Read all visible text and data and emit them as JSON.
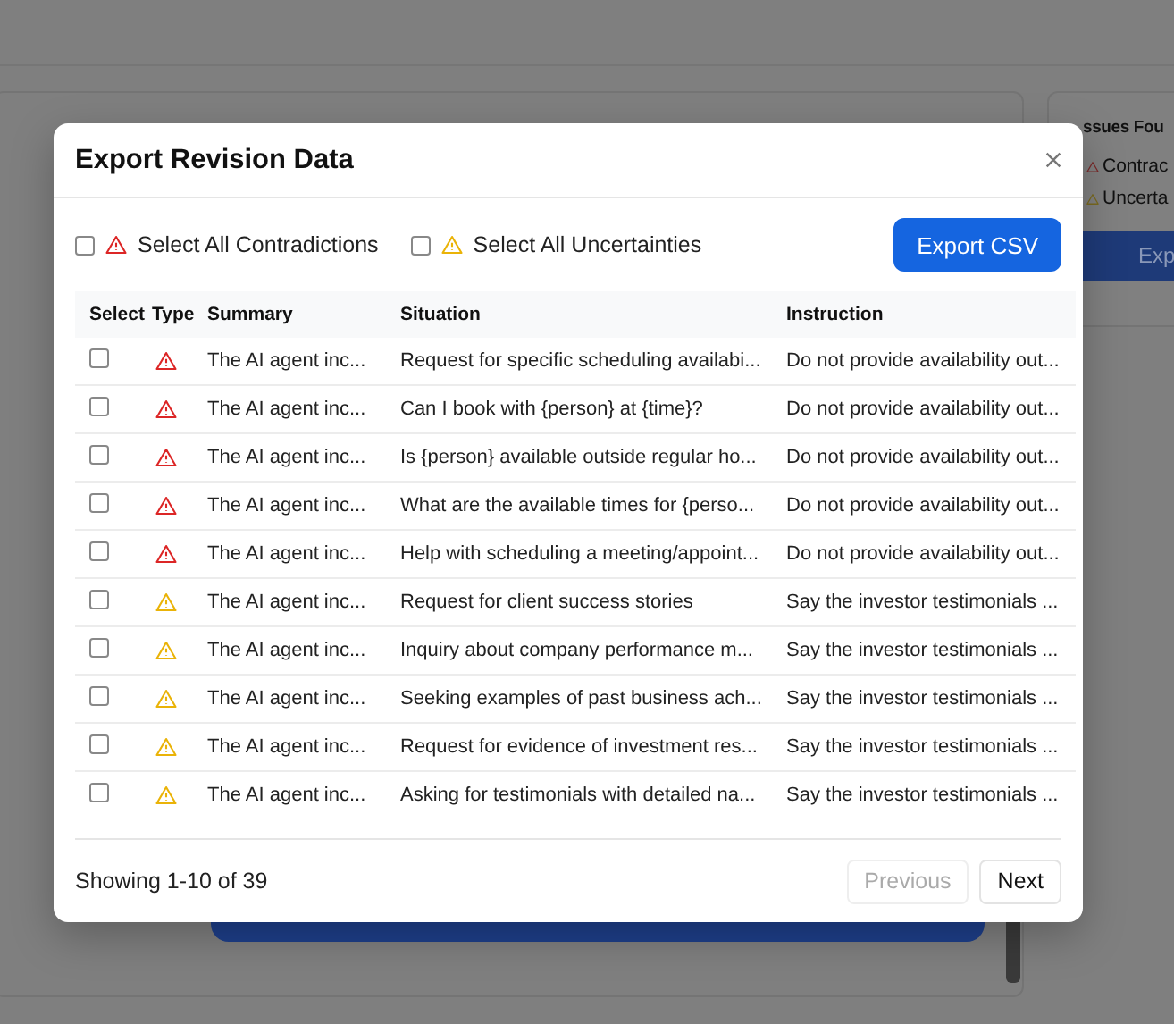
{
  "background": {
    "side_panel": {
      "title": "ssues Fou",
      "items": [
        {
          "kind": "contradiction",
          "label": "Contrac"
        },
        {
          "kind": "uncertainty",
          "label": "Uncerta"
        }
      ],
      "button": "Exp"
    }
  },
  "dialog": {
    "title": "Export Revision Data",
    "select_all": [
      {
        "kind": "contradiction",
        "label": "Select All Contradictions",
        "checked": false
      },
      {
        "kind": "uncertainty",
        "label": "Select All Uncertainties",
        "checked": false
      }
    ],
    "export_button": "Export CSV",
    "table": {
      "columns": [
        "Select",
        "Type",
        "Summary",
        "Situation",
        "Instruction"
      ],
      "rows": [
        {
          "checked": false,
          "kind": "contradiction",
          "summary": "The AI agent inc...",
          "situation": "Request for specific scheduling availabi...",
          "instruction": "Do not provide availability out..."
        },
        {
          "checked": false,
          "kind": "contradiction",
          "summary": "The AI agent inc...",
          "situation": "Can I book with {person} at {time}?",
          "instruction": "Do not provide availability out..."
        },
        {
          "checked": false,
          "kind": "contradiction",
          "summary": "The AI agent inc...",
          "situation": "Is {person} available outside regular ho...",
          "instruction": "Do not provide availability out..."
        },
        {
          "checked": false,
          "kind": "contradiction",
          "summary": "The AI agent inc...",
          "situation": "What are the available times for {perso...",
          "instruction": "Do not provide availability out..."
        },
        {
          "checked": false,
          "kind": "contradiction",
          "summary": "The AI agent inc...",
          "situation": "Help with scheduling a meeting/appoint...",
          "instruction": "Do not provide availability out..."
        },
        {
          "checked": false,
          "kind": "uncertainty",
          "summary": "The AI agent inc...",
          "situation": "Request for client success stories",
          "instruction": "Say the investor testimonials ..."
        },
        {
          "checked": false,
          "kind": "uncertainty",
          "summary": "The AI agent inc...",
          "situation": "Inquiry about company performance m...",
          "instruction": "Say the investor testimonials ..."
        },
        {
          "checked": false,
          "kind": "uncertainty",
          "summary": "The AI agent inc...",
          "situation": "Seeking examples of past business ach...",
          "instruction": "Say the investor testimonials ..."
        },
        {
          "checked": false,
          "kind": "uncertainty",
          "summary": "The AI agent inc...",
          "situation": "Request for evidence of investment res...",
          "instruction": "Say the investor testimonials ..."
        },
        {
          "checked": false,
          "kind": "uncertainty",
          "summary": "The AI agent inc...",
          "situation": "Asking for testimonials with detailed na...",
          "instruction": "Say the investor testimonials ..."
        }
      ]
    },
    "footer": {
      "status": "Showing 1-10 of 39",
      "buttons": [
        {
          "label": "Previous",
          "disabled": true
        },
        {
          "label": "Next",
          "disabled": false
        }
      ]
    }
  }
}
